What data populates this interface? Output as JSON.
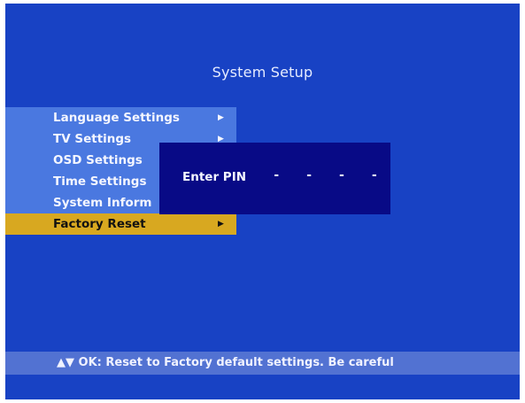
{
  "header": {
    "title": "System Setup"
  },
  "menu": {
    "items": [
      {
        "label": "Language Settings",
        "arrow": "▶"
      },
      {
        "label": "TV Settings",
        "arrow": "▶"
      },
      {
        "label": "OSD Settings",
        "arrow": ""
      },
      {
        "label": "Time Settings",
        "arrow": ""
      },
      {
        "label": "System Inform",
        "arrow": ""
      },
      {
        "label": "Factory Reset",
        "arrow": "▶",
        "selected": true
      }
    ]
  },
  "pin_dialog": {
    "label": "Enter PIN",
    "digits": "- - - -"
  },
  "footer": {
    "hint": "▲▼ OK: Reset to Factory default settings. Be careful"
  },
  "colors": {
    "background": "#1842c4",
    "menu_bg": "#4a78e0",
    "selected": "#d8a820",
    "dialog": "#080a86",
    "footer_bg": "#5272d2"
  }
}
